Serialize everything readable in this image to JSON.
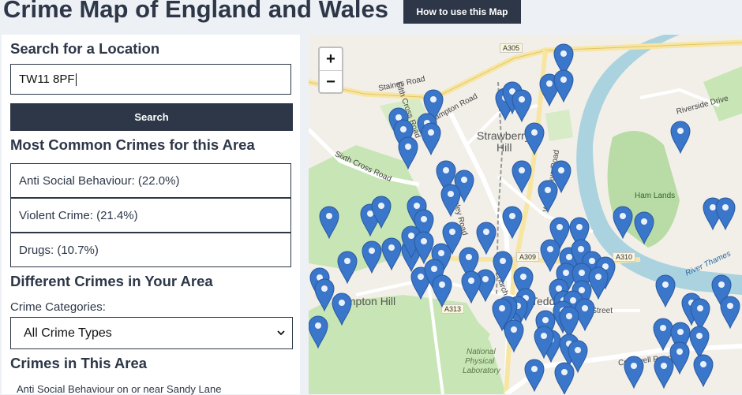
{
  "header": {
    "title": "Crime Map of England and Wales",
    "help_button": "How to use this Map"
  },
  "search": {
    "heading": "Search for a Location",
    "value": "TW11 8PF",
    "button": "Search"
  },
  "common": {
    "heading": "Most Common Crimes for this Area",
    "items": [
      "Anti Social Behaviour: (22.0%)",
      "Violent Crime: (21.4%)",
      "Drugs: (10.7%)"
    ]
  },
  "different": {
    "heading": "Different Crimes in Your Area",
    "label": "Crime Categories:",
    "selected": "All Crime Types"
  },
  "area": {
    "heading": "Crimes in This Area",
    "first_row": "Anti Social Behaviour on or near Sandy Lane"
  },
  "map": {
    "zoom_in": "+",
    "zoom_out": "−",
    "places": [
      "Strawberry",
      "Hill",
      "Hampton Hill",
      "Ham Lands",
      "National",
      "Physical",
      "Laboratory",
      "River Thames"
    ],
    "roads": [
      "A305",
      "A309",
      "A310",
      "A313",
      "Staines Road",
      "Hampton Road",
      "Sixth Cross Road",
      "Riverside Drive",
      "Cromwell Road",
      "Stanley Road",
      "Waldegrave Road",
      "Fifth Cross Road",
      "High Street",
      "Teddington",
      "Church"
    ]
  },
  "colors": {
    "accent": "#2d3748",
    "marker": "#3a76c9",
    "park": "#c8e6b5",
    "water": "#aad3df"
  }
}
